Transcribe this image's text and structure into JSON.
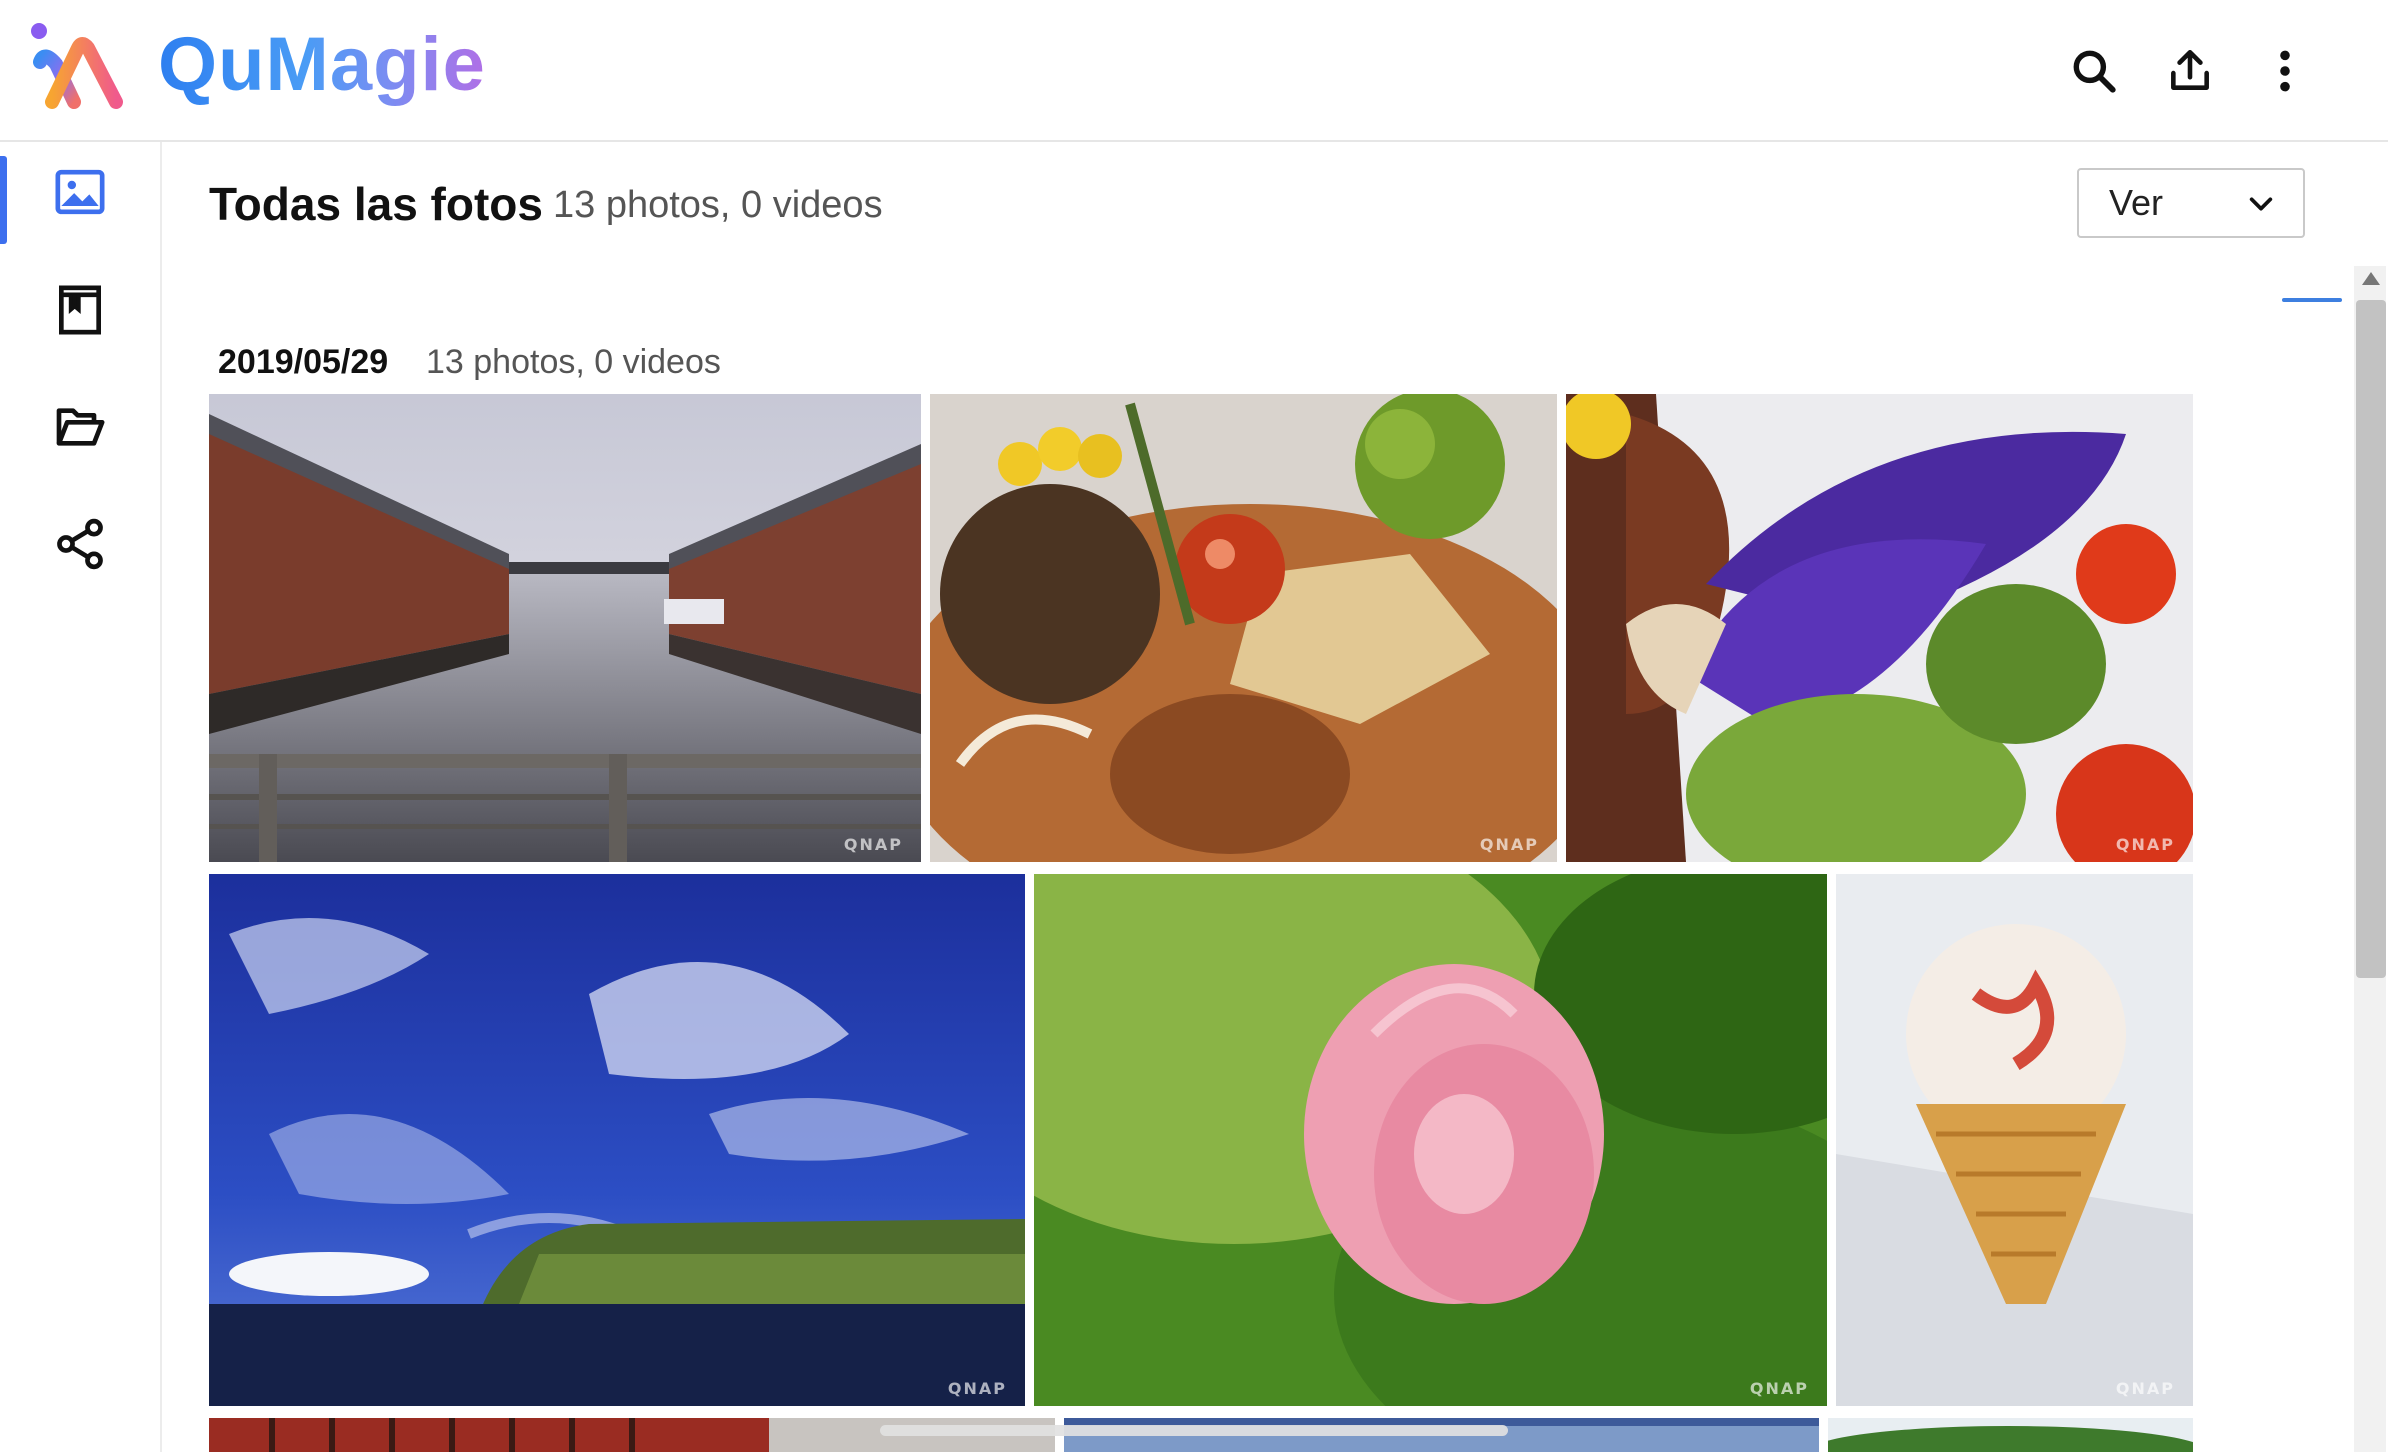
{
  "app": {
    "logo_text": "QuMagie"
  },
  "header": {
    "icons": [
      "search-icon",
      "upload-icon",
      "more-vertical-icon"
    ]
  },
  "sidebar": {
    "items": [
      {
        "icon": "photos-icon",
        "active": true
      },
      {
        "icon": "album-icon",
        "active": false
      },
      {
        "icon": "folder-icon",
        "active": false
      },
      {
        "icon": "share-icon",
        "active": false
      }
    ]
  },
  "main": {
    "title": "Todas las fotos",
    "count": "13 photos, 0 videos",
    "view_select": {
      "label": "Ver"
    }
  },
  "group": {
    "date": "2019/05/29",
    "count": "13 photos, 0 videos"
  },
  "photos": [
    {
      "subject": "brick warehouses along a canal with a boat",
      "watermark": "QNAP"
    },
    {
      "subject": "curry dish with rosemary, corn and tomato",
      "watermark": "QNAP"
    },
    {
      "subject": "grilled eggplant with broccoli and tomato",
      "watermark": "QNAP"
    },
    {
      "subject": "blue sky with clouds over a coastal cliff",
      "watermark": "QNAP"
    },
    {
      "subject": "pink lotus bud on green leaves",
      "watermark": "QNAP"
    },
    {
      "subject": "ice cream cone",
      "watermark": "QNAP"
    }
  ],
  "colors": {
    "accent": "#3d6fee",
    "logo_gradient": [
      "#2e7ff0",
      "#b06fe6"
    ]
  }
}
